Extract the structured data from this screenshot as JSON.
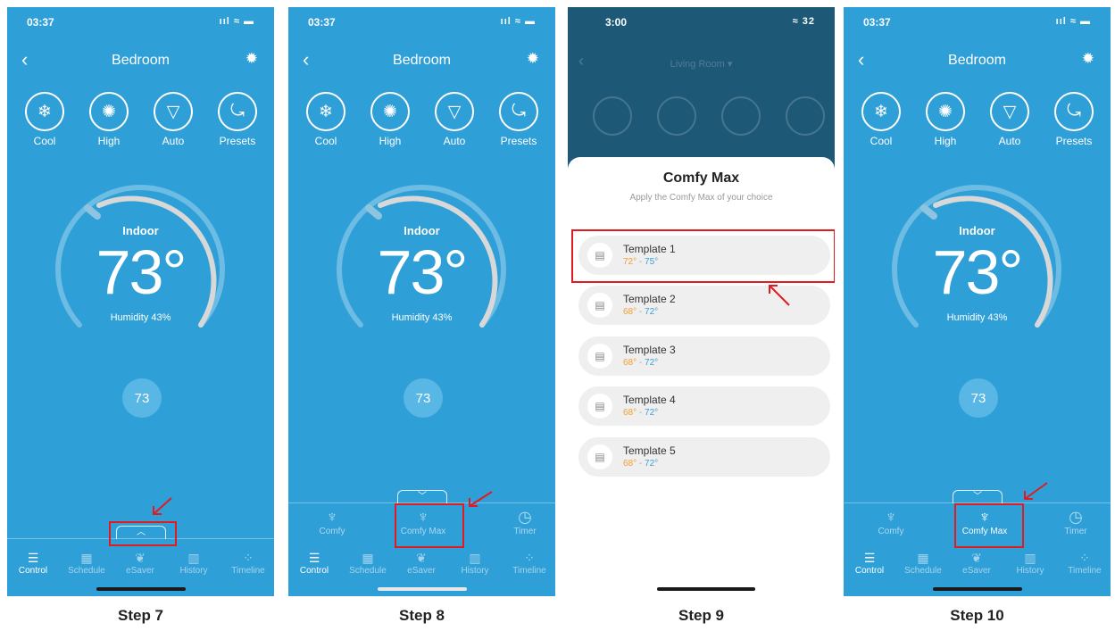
{
  "common": {
    "room": "Bedroom",
    "indoor_label": "Indoor",
    "temp": "73°",
    "humidity": "Humidity 43%",
    "setpoint": "73",
    "modes": [
      "Cool",
      "High",
      "Auto",
      "Presets"
    ],
    "sub_items": [
      "Comfy",
      "Comfy Max",
      "Timer"
    ],
    "nav": [
      "Control",
      "Schedule",
      "eSaver",
      "History",
      "Timeline"
    ],
    "status_time": "03:37",
    "status_icons": "ııl ≈ ▬"
  },
  "steps": [
    "Step 7",
    "Step 8",
    "Step 9",
    "Step 10"
  ],
  "panel3": {
    "status_time": "3:00",
    "status_icons": "≈ 32",
    "dim_title": "Living Room ▾",
    "sheet_title": "Comfy Max",
    "sheet_subtitle": "Apply the Comfy Max of your choice",
    "templates": [
      {
        "name": "Template 1",
        "low": "72°",
        "sep": "-",
        "high": "75°"
      },
      {
        "name": "Template 2",
        "low": "68°",
        "sep": "-",
        "high": "72°"
      },
      {
        "name": "Template 3",
        "low": "68°",
        "sep": "-",
        "high": "72°"
      },
      {
        "name": "Template 4",
        "low": "68°",
        "sep": "-",
        "high": "72°"
      },
      {
        "name": "Template 5",
        "low": "68°",
        "sep": "-",
        "high": "72°"
      }
    ]
  },
  "colors": {
    "phone_bg": "#2f9fd8",
    "highlight": "#e11b22",
    "overlay": "#1d5877"
  },
  "icons": {
    "back": "chevron-left-icon",
    "settings": "gear-icon",
    "cool": "snowflake-icon",
    "high": "fan-icon",
    "auto": "auto-icon",
    "presets": "presets-icon",
    "comfy": "comfy-icon",
    "comfymax": "comfy-max-icon",
    "timer": "timer-icon",
    "control": "sliders-icon",
    "schedule": "calendar-icon",
    "esaver": "leaf-icon",
    "history": "chart-icon",
    "timeline": "timeline-icon",
    "template": "thermostat-icon"
  }
}
